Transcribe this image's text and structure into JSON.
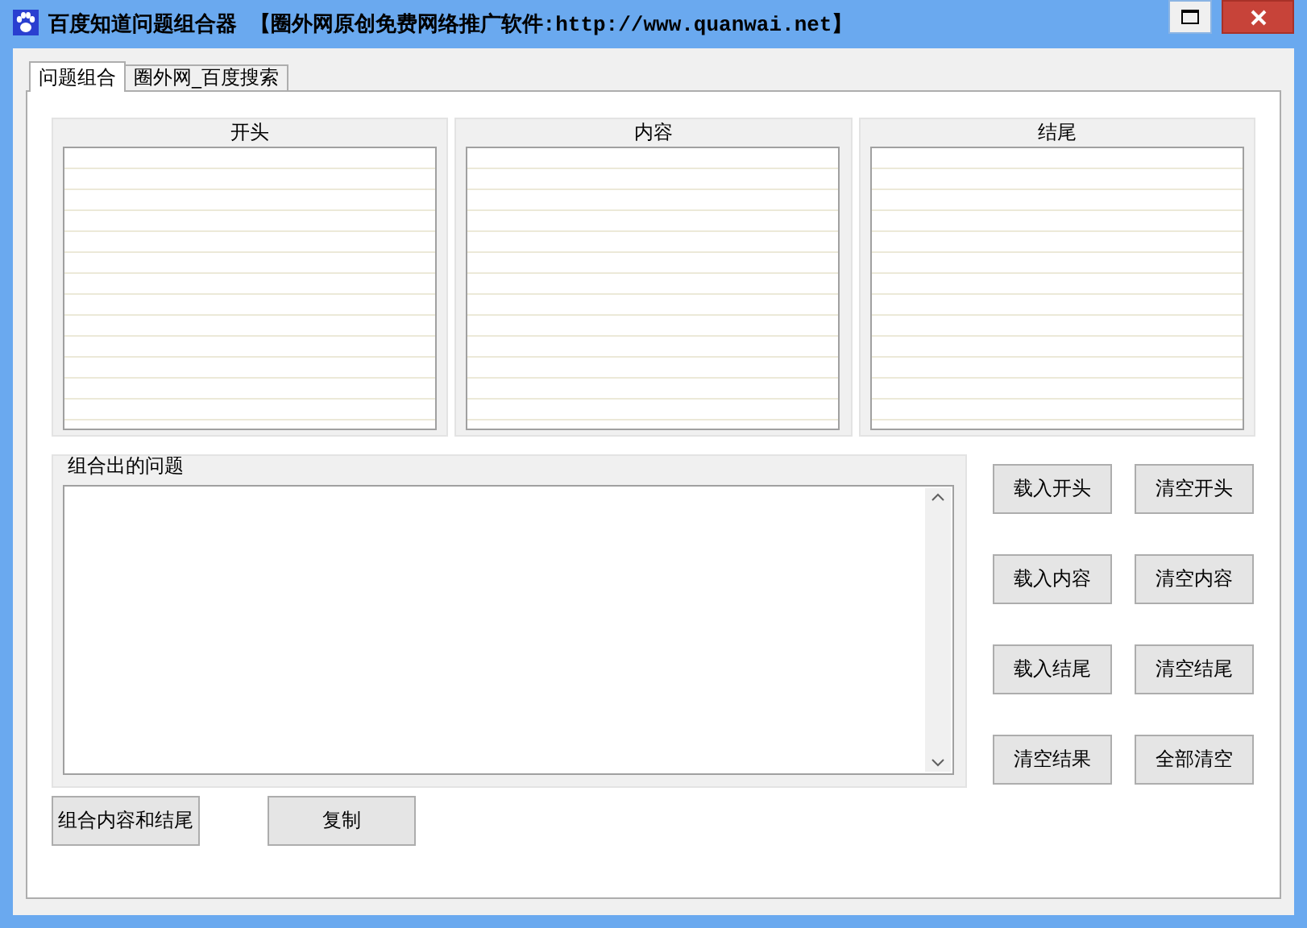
{
  "window": {
    "title": "百度知道问题组合器 【圈外网原创免费网络推广软件:http://www.quanwai.net】"
  },
  "tabs": [
    {
      "label": "问题组合",
      "selected": true
    },
    {
      "label": "圈外网_百度搜索",
      "selected": false
    }
  ],
  "lists": [
    {
      "title": "开头"
    },
    {
      "title": "内容"
    },
    {
      "title": "结尾"
    }
  ],
  "result": {
    "title": "组合出的问题"
  },
  "side_buttons": [
    "载入开头",
    "清空开头",
    "载入内容",
    "清空内容",
    "载入结尾",
    "清空结尾",
    "清空结果",
    "全部清空"
  ],
  "bottom_buttons": [
    "组合内容和结尾",
    "复制"
  ]
}
